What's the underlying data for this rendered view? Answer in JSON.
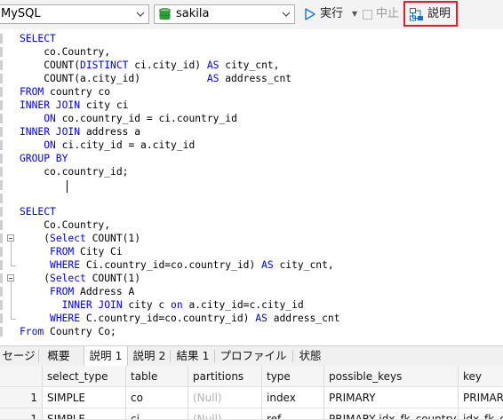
{
  "toolbar": {
    "connection": "MySQL",
    "database": "sakila",
    "run_label": "実行",
    "stop_label": "中止",
    "explain_label": "説明",
    "accent": "#e32020",
    "icons": [
      "database-icon",
      "play-icon",
      "stop-icon",
      "explain-icon",
      "chevron-down-icon"
    ]
  },
  "editor": {
    "lines": [
      [
        {
          "t": "SELECT",
          "k": true
        }
      ],
      [
        {
          "t": "    co.Country,"
        }
      ],
      [
        {
          "t": "    COUNT("
        },
        {
          "t": "DISTINCT",
          "k": true
        },
        {
          "t": " ci.city_id) "
        },
        {
          "t": "AS",
          "k": true
        },
        {
          "t": " city_cnt,"
        }
      ],
      [
        {
          "t": "    COUNT(a.city_id)           "
        },
        {
          "t": "AS",
          "k": true
        },
        {
          "t": " address_cnt"
        }
      ],
      [
        {
          "t": "FROM",
          "k": true
        },
        {
          "t": " country co"
        }
      ],
      [
        {
          "t": "INNER JOIN",
          "k": true
        },
        {
          "t": " city ci"
        }
      ],
      [
        {
          "t": "    "
        },
        {
          "t": "ON",
          "k": true
        },
        {
          "t": " co.country_id = ci.country_id"
        }
      ],
      [
        {
          "t": "INNER JOIN",
          "k": true
        },
        {
          "t": " address a"
        }
      ],
      [
        {
          "t": "    "
        },
        {
          "t": "ON",
          "k": true
        },
        {
          "t": " ci.city_id = a.city_id"
        }
      ],
      [
        {
          "t": "GROUP BY",
          "k": true
        }
      ],
      [
        {
          "t": "    co.country_id;"
        }
      ],
      [],
      [],
      [
        {
          "t": "SELECT",
          "k": true
        }
      ],
      [
        {
          "t": "    Co.Country,"
        }
      ],
      [
        {
          "t": "    ("
        },
        {
          "t": "Select",
          "k": true
        },
        {
          "t": " COUNT(1)"
        }
      ],
      [
        {
          "t": "     "
        },
        {
          "t": "FROM",
          "k": true
        },
        {
          "t": " City Ci"
        }
      ],
      [
        {
          "t": "     "
        },
        {
          "t": "WHERE",
          "k": true
        },
        {
          "t": " Ci.country_id=co.country_id) "
        },
        {
          "t": "AS",
          "k": true
        },
        {
          "t": " city_cnt,"
        }
      ],
      [
        {
          "t": "    ("
        },
        {
          "t": "Select",
          "k": true
        },
        {
          "t": " COUNT(1)"
        }
      ],
      [
        {
          "t": "     "
        },
        {
          "t": "FROM",
          "k": true
        },
        {
          "t": " Address A"
        }
      ],
      [
        {
          "t": "       "
        },
        {
          "t": "INNER JOIN",
          "k": true
        },
        {
          "t": " city c "
        },
        {
          "t": "on",
          "k": true
        },
        {
          "t": " a.city_id=c.city_id"
        }
      ],
      [
        {
          "t": "     "
        },
        {
          "t": "WHERE",
          "k": true
        },
        {
          "t": " C.country_id=co.country_id) "
        },
        {
          "t": "AS",
          "k": true
        },
        {
          "t": " address_cnt"
        }
      ],
      [
        {
          "t": "From",
          "k": true
        },
        {
          "t": " Country Co;"
        }
      ]
    ]
  },
  "tabs": [
    "セージ",
    "概要",
    "説明 1",
    "説明 2",
    "結果 1",
    "プロファイル",
    "状態"
  ],
  "active_tab": "説明 1",
  "grid": {
    "columns": [
      "",
      "select_type",
      "table",
      "partitions",
      "type",
      "possible_keys",
      "key"
    ],
    "rows": [
      [
        "1",
        "SIMPLE",
        "co",
        "(Null)",
        "index",
        "PRIMARY",
        "PRIMARY"
      ],
      [
        "1",
        "SIMPLE",
        "ci",
        "(Null)",
        "ref",
        "PRIMARY,idx_fk_country_id",
        "idx_fk_co"
      ]
    ]
  }
}
